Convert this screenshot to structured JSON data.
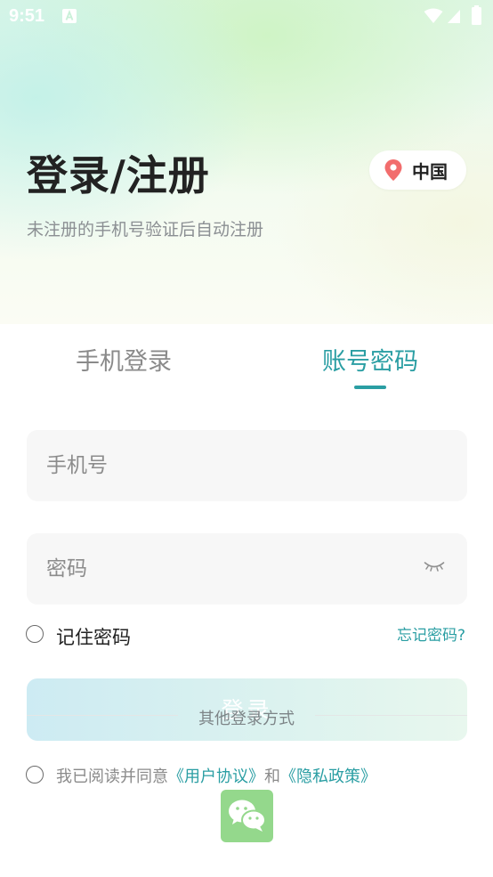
{
  "status_bar": {
    "time": "9:51",
    "colors": {
      "icons": "#ffffff"
    }
  },
  "header": {
    "title": "登录/注册",
    "subtitle": "未注册的手机号验证后自动注册",
    "region": {
      "icon": "location-pin-icon",
      "label": "中国",
      "icon_color": "#f26d6d"
    }
  },
  "tabs": [
    {
      "label": "手机登录",
      "active": false
    },
    {
      "label": "账号密码",
      "active": true
    }
  ],
  "form": {
    "phone_placeholder": "手机号",
    "phone_value": "",
    "password_placeholder": "密码",
    "password_value": "",
    "password_toggle_icon": "eye-closed-icon",
    "remember_label": "记住密码",
    "remember_checked": false,
    "forgot_label": "忘记密码?",
    "login_label": "登录"
  },
  "other_login": {
    "label": "其他登录方式",
    "methods": [
      {
        "icon": "wechat-icon"
      }
    ]
  },
  "agreement": {
    "checked": false,
    "prefix": "我已阅读并同意",
    "user_agreement": "《用户协议》",
    "conjunction": "和",
    "privacy_policy": "《隐私政策》"
  },
  "colors": {
    "accent": "#2a9ea3",
    "wechat": "#94d88c",
    "title": "#222222",
    "muted": "#8a8a8a"
  }
}
